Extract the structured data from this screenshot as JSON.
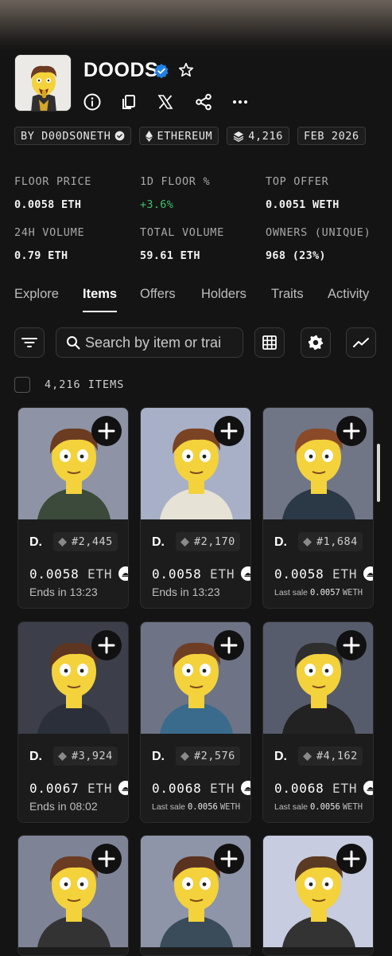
{
  "collection": {
    "title": "DOODS",
    "icons": {
      "verified": "verified-badge-icon",
      "favorite": "star-icon"
    },
    "actions": [
      {
        "name": "info-button",
        "icon": "info-icon"
      },
      {
        "name": "copy-button",
        "icon": "copy-icon"
      },
      {
        "name": "x-button",
        "icon": "x-logo-icon"
      },
      {
        "name": "share-button",
        "icon": "share-icon"
      },
      {
        "name": "more-button",
        "icon": "more-icon"
      }
    ],
    "chips": {
      "creator": "BY D00DSONETH",
      "chain": "ETHEREUM",
      "supply": "4,216",
      "date": "FEB 2026"
    }
  },
  "stats": [
    {
      "label": "FLOOR PRICE",
      "value": "0.0058 ETH"
    },
    {
      "label": "1D FLOOR %",
      "value": "+3.6%",
      "color": "#3fbf6a"
    },
    {
      "label": "TOP OFFER",
      "value": "0.0051 WETH"
    },
    {
      "label": "24H VOLUME",
      "value": "0.79 ETH"
    },
    {
      "label": "TOTAL VOLUME",
      "value": "59.61 ETH"
    },
    {
      "label": "OWNERS (UNIQUE)",
      "value": "968 (23%)"
    }
  ],
  "tabs": [
    "Explore",
    "Items",
    "Offers",
    "Holders",
    "Traits",
    "Activity"
  ],
  "active_tab": "Items",
  "search": {
    "placeholder": "Search by item or trai"
  },
  "items_count": "4,216 ITEMS",
  "cards": [
    {
      "name": "D.",
      "token": "#2,445",
      "price": "0.0058",
      "unit": "ETH",
      "sub_type": "ends",
      "sub": "Ends in 13:23",
      "bg": "#8e94a6"
    },
    {
      "name": "D.",
      "token": "#2,170",
      "price": "0.0058",
      "unit": "ETH",
      "sub_type": "ends",
      "sub": "Ends in 13:23",
      "bg": "#a7b0c6"
    },
    {
      "name": "D.",
      "token": "#1,684",
      "price": "0.0058",
      "unit": "ETH",
      "sub_type": "last",
      "sub_label": "Last sale",
      "sub_value": "0.0057",
      "sub_unit": "WETH",
      "bg": "#717687"
    },
    {
      "name": "D.",
      "token": "#3,924",
      "price": "0.0067",
      "unit": "ETH",
      "sub_type": "ends",
      "sub": "Ends in 08:02",
      "bg": "#3c3f4a"
    },
    {
      "name": "D.",
      "token": "#2,576",
      "price": "0.0068",
      "unit": "ETH",
      "sub_type": "last",
      "sub_label": "Last sale",
      "sub_value": "0.0056",
      "sub_unit": "WETH",
      "bg": "#6e7385"
    },
    {
      "name": "D.",
      "token": "#4,162",
      "price": "0.0068",
      "unit": "ETH",
      "sub_type": "last",
      "sub_label": "Last sale",
      "sub_value": "0.0056",
      "sub_unit": "WETH",
      "bg": "#575c6c"
    },
    {
      "name": "",
      "token": "",
      "price": "",
      "unit": "",
      "sub_type": "none",
      "bg": "#7e8496"
    },
    {
      "name": "",
      "token": "",
      "price": "",
      "unit": "",
      "sub_type": "none",
      "bg": "#8e95a8"
    },
    {
      "name": "",
      "token": "",
      "price": "",
      "unit": "",
      "sub_type": "none",
      "bg": "#c7cce0"
    }
  ]
}
